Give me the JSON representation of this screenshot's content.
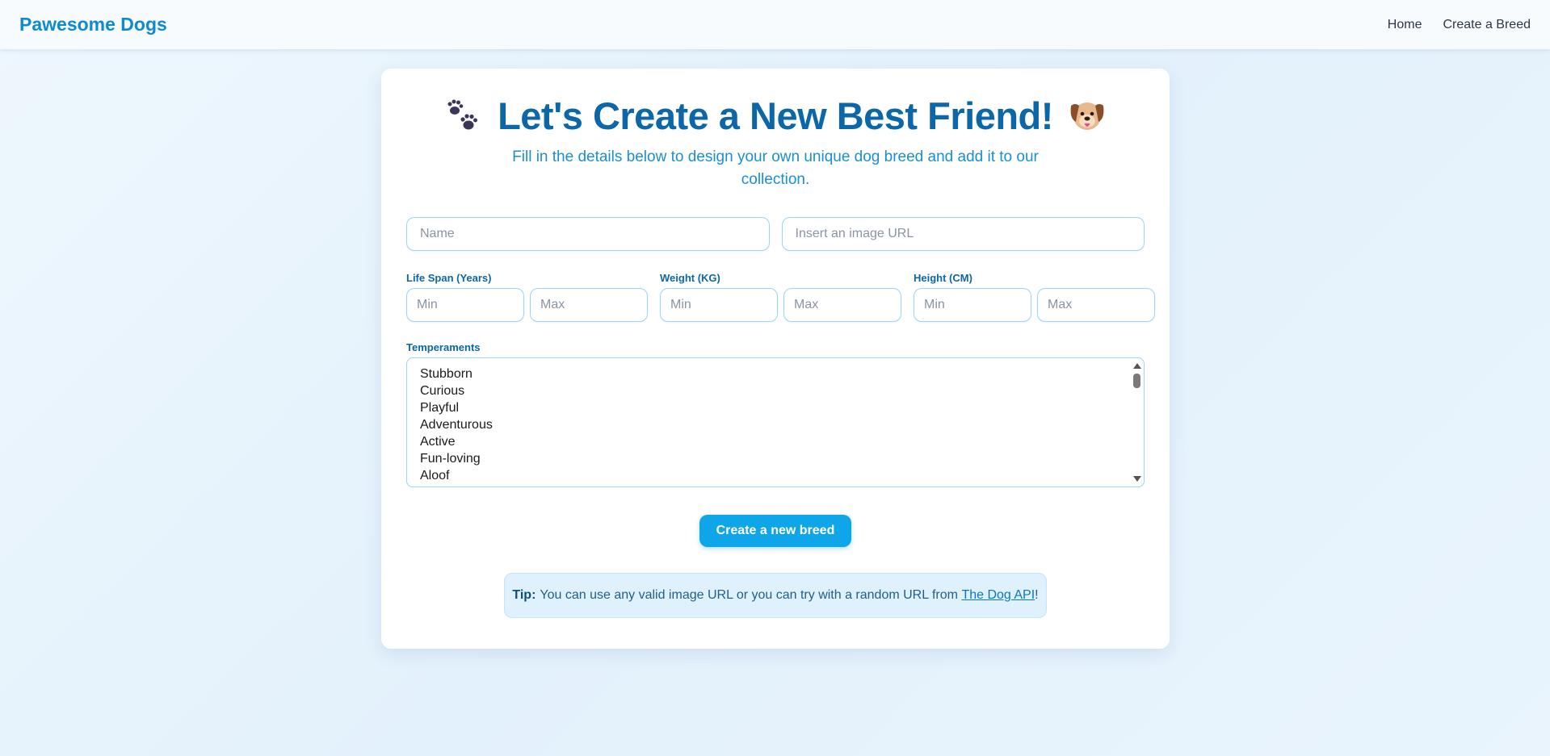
{
  "nav": {
    "brand": "Pawesome Dogs",
    "links": [
      "Home",
      "Create a Breed"
    ]
  },
  "header": {
    "title": "Let's Create a New Best Friend!",
    "subtitle": "Fill in the details below to design your own unique dog breed and add it to our collection.",
    "left_icon": "paw-prints-icon",
    "right_icon": "dog-face-icon"
  },
  "form": {
    "name_placeholder": "Name",
    "image_placeholder": "Insert an image URL",
    "life_span_label": "Life Span (Years)",
    "weight_label": "Weight (KG)",
    "height_label": "Height (CM)",
    "min_placeholder": "Min",
    "max_placeholder": "Max",
    "temperaments_label": "Temperaments",
    "temperaments": [
      "Stubborn",
      "Curious",
      "Playful",
      "Adventurous",
      "Active",
      "Fun-loving",
      "Aloof"
    ],
    "submit_label": "Create a new breed"
  },
  "tip": {
    "label": "Tip:",
    "text": "You can use any valid image URL or you can try with a random URL from",
    "link": "The Dog API",
    "suffix": "!"
  },
  "colors": {
    "brand": "#0e8ad2",
    "title": "#0b67a8",
    "button": "#0ea5e9",
    "input_border": "#9fd4f0"
  }
}
